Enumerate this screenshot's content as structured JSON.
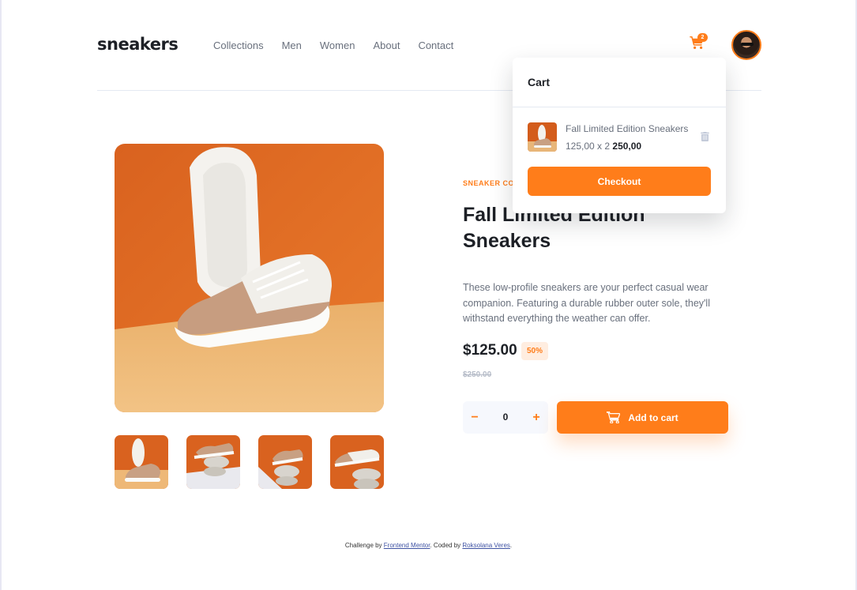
{
  "header": {
    "logo": "sneakers",
    "nav": [
      "Collections",
      "Men",
      "Women",
      "About",
      "Contact"
    ],
    "cart_count": "2"
  },
  "cart": {
    "title": "Cart",
    "item": {
      "name": "Fall Limited Edition Sneakers",
      "unit_price_qty": "125,00 x 2",
      "total": "250,00"
    },
    "checkout_label": "Checkout"
  },
  "product": {
    "company": "Sneaker Company",
    "title": "Fall Limited Edition Sneakers",
    "description": "These low-profile sneakers are your perfect casual wear companion. Featuring a durable rubber outer sole, they'll withstand everything the weather can offer.",
    "price": "$125.00",
    "discount": "50%",
    "old_price": "$250.00",
    "quantity": "0",
    "minus_label": "−",
    "plus_label": "+",
    "add_to_cart_label": "Add to cart"
  },
  "footer": {
    "prefix": "Challenge by ",
    "link1": "Frontend Mentor",
    "middle": ". Coded by ",
    "link2": "Roksolana Veres",
    "suffix": "."
  },
  "colors": {
    "accent": "#ff7d1a",
    "accent_pale": "#ffede0",
    "text_dark": "#1d2026",
    "text_gray": "#69707d"
  }
}
